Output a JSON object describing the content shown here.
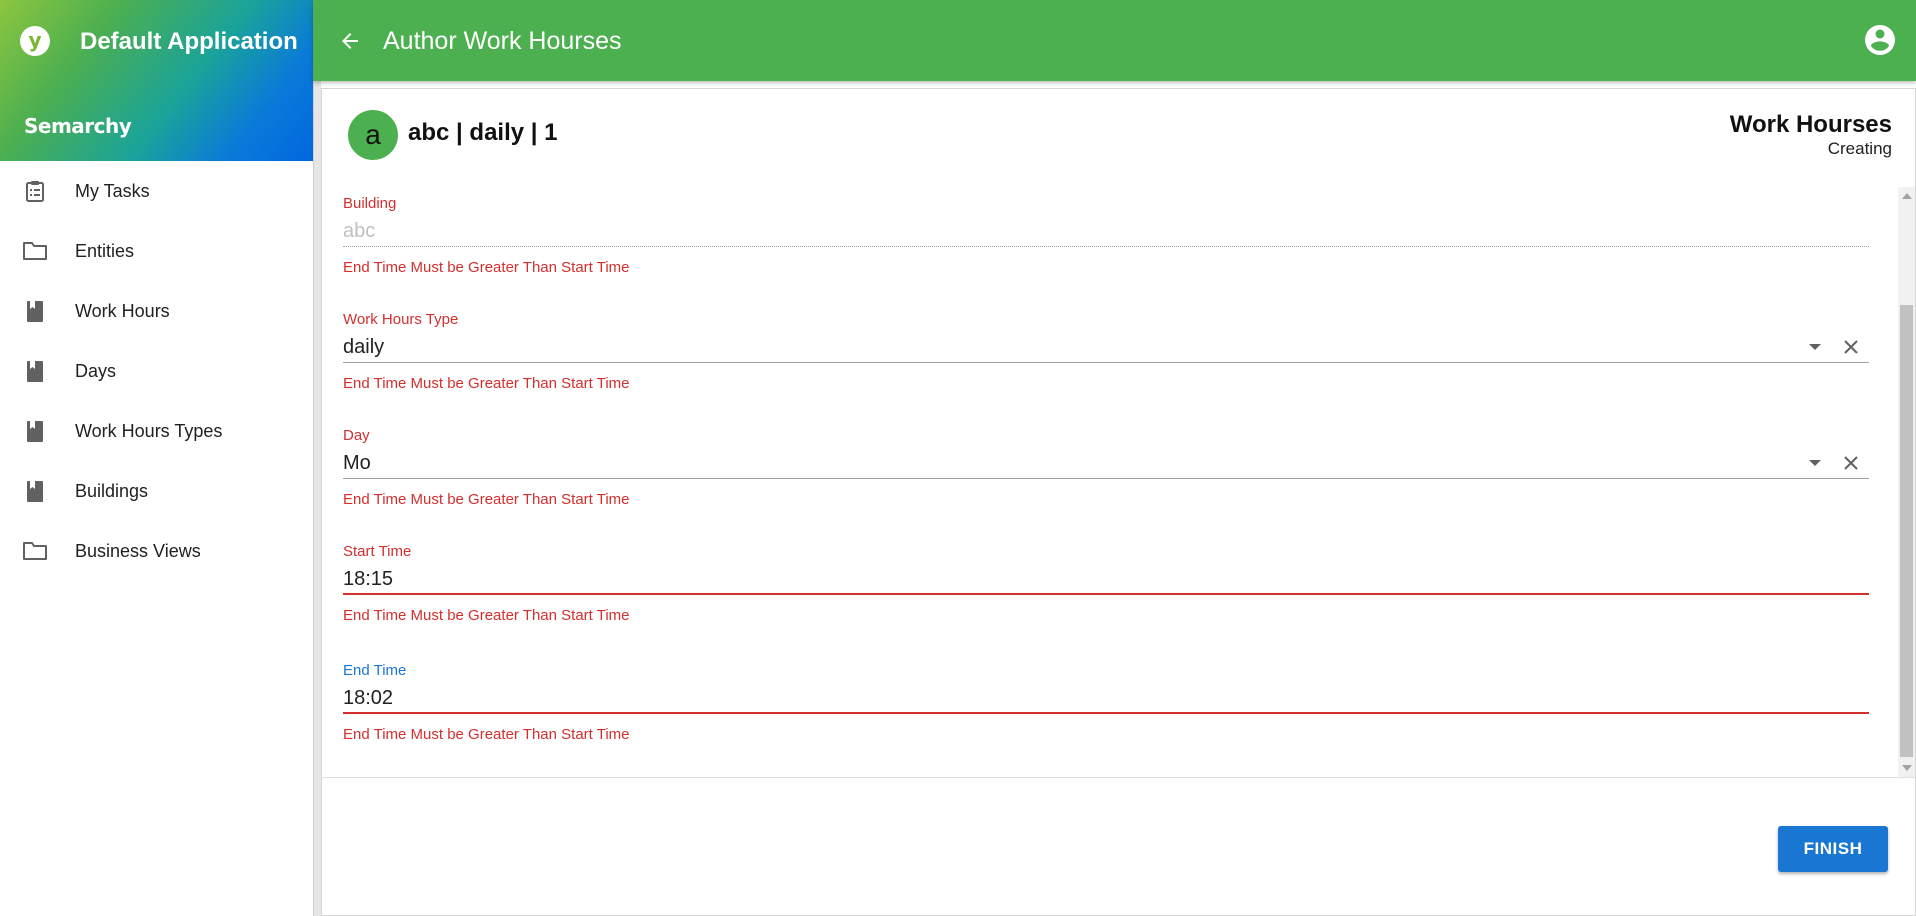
{
  "sidebar": {
    "app_title": "Default Application",
    "company": "Semarchy",
    "logo_letter": "y",
    "items": [
      {
        "label": "My Tasks",
        "icon": "clipboard-list-icon"
      },
      {
        "label": "Entities",
        "icon": "folder-icon"
      },
      {
        "label": "Work Hours",
        "icon": "bookmark-book-icon"
      },
      {
        "label": "Days",
        "icon": "bookmark-book-icon"
      },
      {
        "label": "Work Hours Types",
        "icon": "bookmark-book-icon"
      },
      {
        "label": "Buildings",
        "icon": "bookmark-book-icon"
      },
      {
        "label": "Business Views",
        "icon": "folder-icon"
      }
    ]
  },
  "topbar": {
    "title": "Author Work Hourses",
    "back_icon": "arrow-left-icon",
    "account_icon": "account-circle-icon"
  },
  "card": {
    "avatar_letter": "a",
    "record_title": "abc | daily | 1",
    "entity_name": "Work Hourses",
    "status": "Creating"
  },
  "form": {
    "fields": [
      {
        "label": "Building",
        "value": "abc",
        "helper": "End Time Must be Greater Than Start Time"
      },
      {
        "label": "Work Hours Type",
        "value": "daily",
        "helper": "End Time Must be Greater Than Start Time"
      },
      {
        "label": "Day",
        "value": "Mo",
        "helper": "End Time Must be Greater Than Start Time"
      },
      {
        "label": "Start Time",
        "value": "18:15",
        "helper": "End Time Must be Greater Than Start Time"
      },
      {
        "label": "End Time",
        "value": "18:02",
        "helper": "End Time Must be Greater Than Start Time"
      }
    ]
  },
  "actions": {
    "finish_label": "FINISH"
  },
  "colors": {
    "topbar": "#4caf50",
    "error": "#d32f2f",
    "primary": "#1976d2"
  }
}
